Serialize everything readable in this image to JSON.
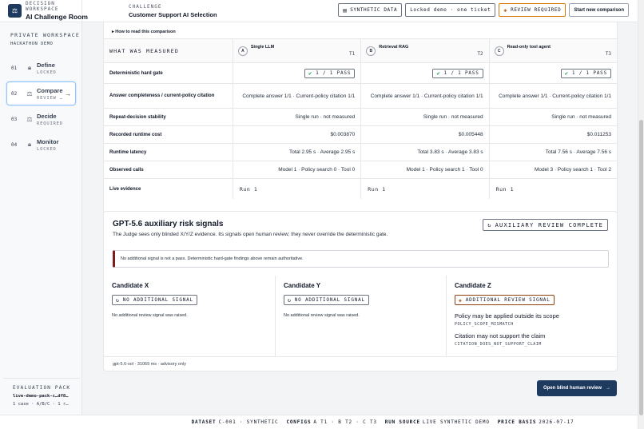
{
  "brand": {
    "kicker": "DECISION WORKSPACE",
    "title": "AI Challenge Room"
  },
  "challenge": {
    "kicker": "CHALLENGE",
    "title": "Customer Support AI Selection"
  },
  "top_actions": {
    "synthetic": "SYNTHETIC DATA",
    "locked": "Locked demo · one ticket",
    "review": "REVIEW REQUIRED",
    "start": "Start new comparison"
  },
  "sidebar": {
    "ws_kicker": "PRIVATE WORKSPACE",
    "ws_sub": "HACKATHON DEMO",
    "steps": [
      {
        "num": "01",
        "label": "Define",
        "sub": "LOCKED"
      },
      {
        "num": "02",
        "label": "Compare",
        "sub": "REVIEW …"
      },
      {
        "num": "03",
        "label": "Decide",
        "sub": "REQUIRED"
      },
      {
        "num": "04",
        "label": "Monitor",
        "sub": "LOCKED"
      }
    ],
    "evidence": {
      "kicker": "EVALUATION PACK",
      "id": "live-demo-pack-c…df8…",
      "meta": "1 case · A/B/C · 1 r…"
    }
  },
  "comparison": {
    "howto": "▸ How to read this comparison",
    "header_label": "WHAT WAS MEASURED",
    "models": [
      {
        "badge": "A",
        "name": "Single LLM",
        "tier": "T1"
      },
      {
        "badge": "B",
        "name": "Retrieval RAG",
        "tier": "T2"
      },
      {
        "badge": "C",
        "name": "Read-only tool agent",
        "tier": "T3"
      }
    ],
    "rows": [
      {
        "label": "Deterministic hard gate",
        "cells": [
          "1 / 1 PASS",
          "1 / 1 PASS",
          "1 / 1 PASS"
        ]
      },
      {
        "label": "Answer completeness / current-policy citation",
        "cells": [
          "Complete answer 1/1 · Current-policy citation 1/1",
          "Complete answer 1/1 · Current-policy citation 1/1",
          "Complete answer 1/1 · Current-policy citation 1/1"
        ]
      },
      {
        "label": "Repeat-decision stability",
        "cells": [
          "Single run · not measured",
          "Single run · not measured",
          "Single run · not measured"
        ]
      },
      {
        "label": "Recorded runtime cost",
        "cells": [
          "$0.003870",
          "$0.005448",
          "$0.011253"
        ]
      },
      {
        "label": "Runtime latency",
        "cells": [
          "Total 2.95 s · Average 2.95 s",
          "Total 3.83 s · Average 3.83 s",
          "Total 7.56 s · Average 7.56 s"
        ]
      },
      {
        "label": "Observed calls",
        "cells": [
          "Model 1 · Policy search 0 · Tool 0",
          "Model 1 · Policy search 1 · Tool 0",
          "Model 3 · Policy search 1 · Tool 2"
        ]
      },
      {
        "label": "Live evidence",
        "cells": [
          "Run 1",
          "Run 1",
          "Run 1"
        ]
      }
    ]
  },
  "aux": {
    "title": "GPT-5.6 auxiliary risk signals",
    "subtitle": "The Judge sees only blinded X/Y/Z evidence. Its signals open human review; they never override the deterministic gate.",
    "status": "AUXILIARY REVIEW COMPLETE",
    "notice": "No additional signal is not a pass. Deterministic hard-gate findings above remain authoritative.",
    "candidates": [
      {
        "name": "Candidate X",
        "signal": "NO ADDITIONAL SIGNAL",
        "note": "No additional review signal was raised."
      },
      {
        "name": "Candidate Y",
        "signal": "NO ADDITIONAL SIGNAL",
        "note": "No additional review signal was raised."
      },
      {
        "name": "Candidate Z",
        "signal": "ADDITIONAL REVIEW SIGNAL",
        "findings": [
          {
            "text": "Policy may be applied outside its scope",
            "code": "POLICY_SCOPE_MISMATCH"
          },
          {
            "text": "Citation may not support the claim",
            "code": "CITATION_DOES_NOT_SUPPORT_CLAIM"
          }
        ]
      }
    ],
    "footer": "gpt-5.6-sol · 31069 ms · advisory only"
  },
  "open_button": "Open blind human review",
  "footer": {
    "dataset_k": "DATASET",
    "dataset_v": "C-001 · SYNTHETIC",
    "configs_k": "CONFIGS",
    "configs_v": "A T1 · B T2 · C T3",
    "run_k": "RUN SOURCE",
    "run_v": "LIVE SYNTHETIC DEMO",
    "price_k": "PRICE BASIS",
    "price_v": "2026-07-17"
  }
}
